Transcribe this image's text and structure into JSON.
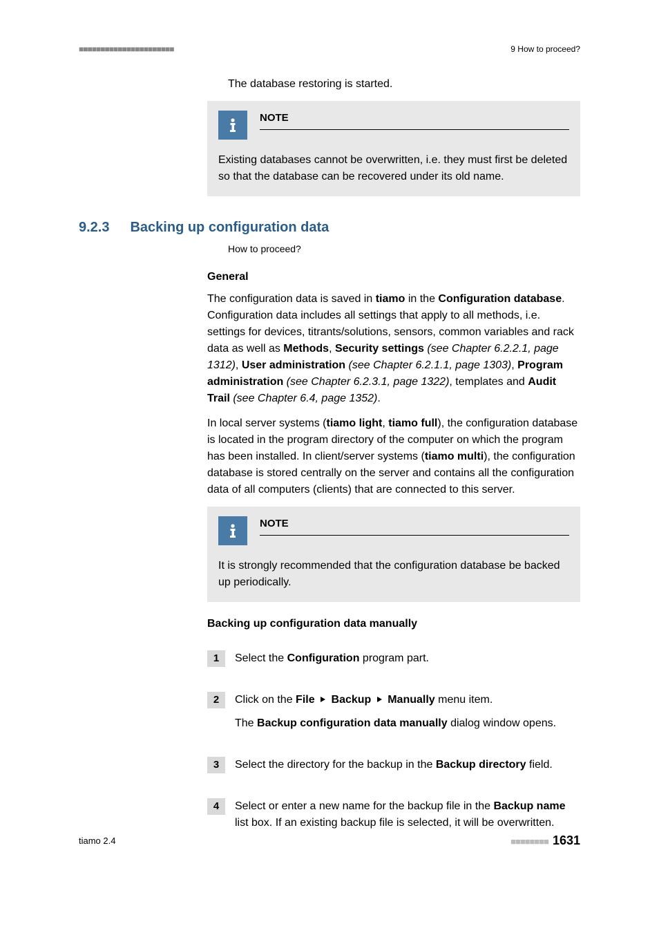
{
  "header": {
    "dots_left": "■■■■■■■■■■■■■■■■■■■■■■",
    "chapter_ref": "9 How to proceed?"
  },
  "intro": {
    "restore_started": "The database restoring is started."
  },
  "note1": {
    "label": "NOTE",
    "body": "Existing databases cannot be overwritten, i.e. they must first be deleted so that the database can be recovered under its old name."
  },
  "section": {
    "number": "9.2.3",
    "title": "Backing up configuration data",
    "subtitle": "How to proceed?"
  },
  "general": {
    "heading": "General",
    "p1_a": "The configuration data is saved in ",
    "p1_b": "tiamo",
    "p1_c": " in the ",
    "p1_d": "Configuration database",
    "p1_e": ". Configuration data includes all settings that apply to all methods, i.e. settings for devices, titrants/solutions, sensors, common variables and rack data as well as ",
    "p1_f": "Methods",
    "p1_g": ", ",
    "p1_h": "Security settings",
    "p1_i": " (see Chapter 6.2.2.1, page 1312)",
    "p1_j": ", ",
    "p1_k": "User administration",
    "p1_l": " (see Chapter 6.2.1.1, page 1303)",
    "p1_m": ", ",
    "p1_n": "Program administration",
    "p1_o": " (see Chapter 6.2.3.1, page 1322)",
    "p1_p": ", templates and ",
    "p1_q": "Audit Trail",
    "p1_r": " (see Chapter 6.4, page 1352)",
    "p1_s": ".",
    "p2_a": "In local server systems (",
    "p2_b": "tiamo light",
    "p2_c": ", ",
    "p2_d": "tiamo full",
    "p2_e": "), the configuration database is located in the program directory of the computer on which the program has been installed. In client/server systems (",
    "p2_f": "tiamo multi",
    "p2_g": "), the configuration database is stored centrally on the server and contains all the configuration data of all computers (clients) that are connected to this server."
  },
  "note2": {
    "label": "NOTE",
    "body": "It is strongly recommended that the configuration database be backed up periodically."
  },
  "manual": {
    "heading": "Backing up configuration data manually",
    "step1_a": "Select the ",
    "step1_b": "Configuration",
    "step1_c": " program part.",
    "step2_a": "Click on the ",
    "step2_b": "File",
    "step2_c": "Backup",
    "step2_d": "Manually",
    "step2_e": " menu item.",
    "step2_f": "The ",
    "step2_g": "Backup configuration data manually",
    "step2_h": " dialog window opens.",
    "step3_a": "Select the directory for the backup in the ",
    "step3_b": "Backup directory",
    "step3_c": " field.",
    "step4_a": "Select or enter a new name for the backup file in the ",
    "step4_b": "Backup name",
    "step4_c": " list box. If an existing backup file is selected, it will be overwritten.",
    "nums": {
      "n1": "1",
      "n2": "2",
      "n3": "3",
      "n4": "4"
    }
  },
  "footer": {
    "product": "tiamo 2.4",
    "dots_right": "■■■■■■■■",
    "page": "1631"
  }
}
